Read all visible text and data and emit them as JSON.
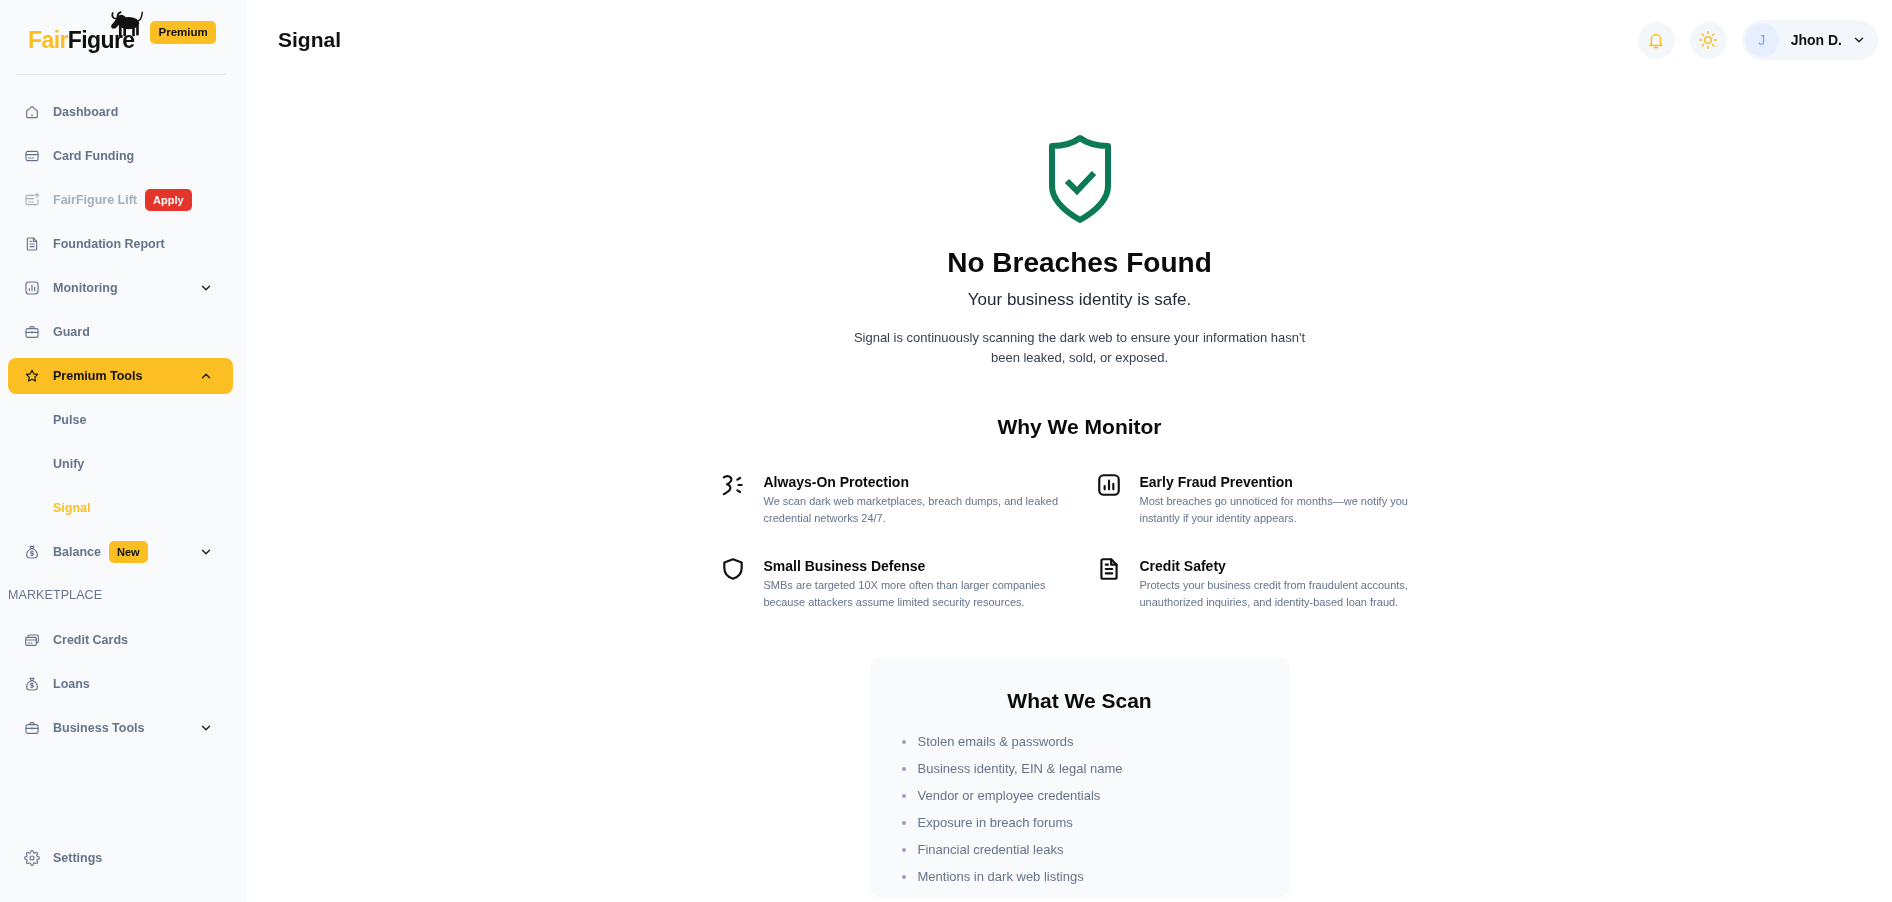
{
  "sidebar": {
    "logo": {
      "accent": "Fair",
      "rest": "Figure"
    },
    "plan_badge": "Premium",
    "nav": [
      {
        "label": "Dashboard",
        "kind": "link",
        "selected": false,
        "disabled": false
      },
      {
        "label": "Card Funding",
        "kind": "link",
        "selected": false,
        "disabled": false
      },
      {
        "label": "FairFigure Lift",
        "kind": "link",
        "selected": false,
        "disabled": true,
        "badge": {
          "label": "Apply",
          "color": "#e5352b"
        }
      },
      {
        "label": "Foundation Report",
        "kind": "link",
        "selected": false,
        "disabled": false
      },
      {
        "label": "Monitoring",
        "kind": "group",
        "selected": false,
        "disabled": false,
        "expanded": false
      },
      {
        "label": "Guard",
        "kind": "link",
        "selected": false,
        "disabled": false
      },
      {
        "label": "Premium Tools",
        "kind": "group",
        "selected": true,
        "disabled": false,
        "expanded": true,
        "children": [
          {
            "label": "Pulse",
            "selected": false
          },
          {
            "label": "Unify",
            "selected": false
          },
          {
            "label": "Signal",
            "selected": true
          }
        ]
      },
      {
        "label": "Balance",
        "kind": "group",
        "selected": false,
        "disabled": false,
        "expanded": false,
        "badge": {
          "label": "New",
          "color": "#fbbf24"
        }
      }
    ],
    "sections": [
      {
        "heading": "MARKETPLACE",
        "items": [
          {
            "label": "Credit Cards",
            "kind": "link",
            "selected": false
          },
          {
            "label": "Loans",
            "kind": "link",
            "selected": false
          },
          {
            "label": "Business Tools",
            "kind": "group",
            "selected": false,
            "expanded": false
          }
        ]
      }
    ],
    "footer_items": [
      {
        "label": "Settings",
        "selected": false
      }
    ]
  },
  "header": {
    "title": "Signal",
    "user": {
      "initial": "J",
      "name": "Jhon D."
    }
  },
  "status": {
    "heading": "No Breaches Found",
    "subheading": "Your business identity is safe.",
    "description": "Signal is continuously scanning the dark web to ensure your information hasn't been leaked, sold, or exposed."
  },
  "why_we_monitor": {
    "heading": "Why We Monitor",
    "features": [
      {
        "title": "Always-On Protection",
        "description": "We scan dark web marketplaces, breach dumps, and leaked credential networks 24/7."
      },
      {
        "title": "Early Fraud Prevention",
        "description": "Most breaches go unnoticed for months—we notify you instantly if your identity appears."
      },
      {
        "title": "Small Business Defense",
        "description": "SMBs are targeted 10X more often than larger companies because attackers assume limited security resources."
      },
      {
        "title": "Credit Safety",
        "description": "Protects your business credit from fraudulent accounts, unauthorized inquiries, and identity-based loan fraud."
      }
    ]
  },
  "what_we_scan": {
    "heading": "What We Scan",
    "items": [
      "Stolen emails & passwords",
      "Business identity, EIN & legal name",
      "Vendor or employee credentials",
      "Exposure in breach forums",
      "Financial credential leaks",
      "Mentions in dark web listings"
    ]
  }
}
